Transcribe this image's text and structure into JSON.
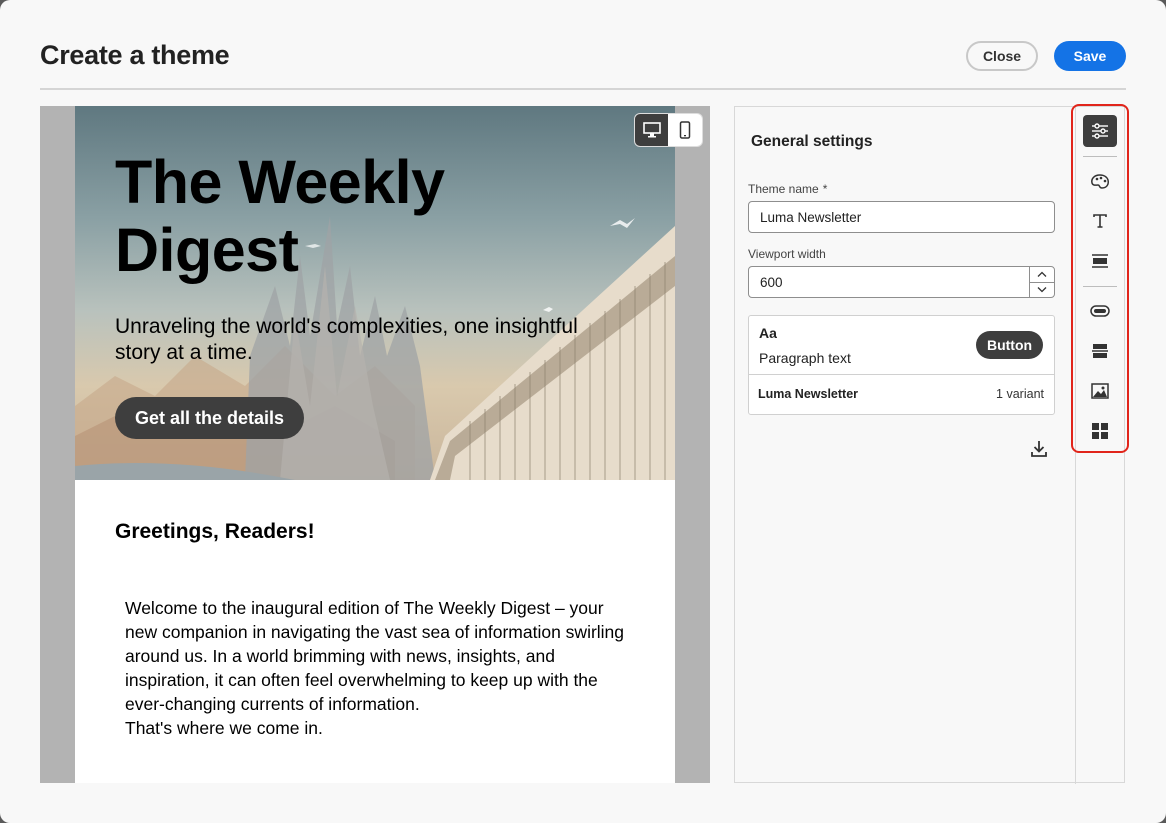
{
  "dialog": {
    "title": "Create a theme",
    "close_label": "Close",
    "save_label": "Save"
  },
  "preview": {
    "device_modes": [
      {
        "name": "desktop",
        "icon": "desktop-icon",
        "active": true
      },
      {
        "name": "mobile",
        "icon": "mobile-icon",
        "active": false
      }
    ],
    "email": {
      "hero_title": "The Weekly Digest",
      "hero_subtitle": "Unraveling the world's complexities, one insightful story at a time.",
      "cta_label": "Get all the details",
      "greeting": "Greetings, Readers!",
      "body": "Welcome to the inaugural edition of The Weekly Digest – your new companion in navigating the vast sea of information swirling around us. In a world brimming with news, insights, and inspiration, it can often feel overwhelming to keep up with the ever-changing currents of information.\nThat's where we come in."
    }
  },
  "settings": {
    "heading": "General settings",
    "theme_name": {
      "label": "Theme name",
      "required_mark": "*",
      "value": "Luma Newsletter"
    },
    "viewport_width": {
      "label": "Viewport width",
      "value": "600"
    },
    "theme_card": {
      "typography_sample": "Aa",
      "paragraph_sample": "Paragraph text",
      "button_sample": "Button",
      "theme_name": "Luma Newsletter",
      "variant_count": "1 variant"
    }
  },
  "rail": {
    "items": [
      {
        "name": "general-settings",
        "icon": "sliders-icon",
        "active": true
      },
      {
        "name": "colors",
        "icon": "palette-icon",
        "active": false
      },
      {
        "name": "typography",
        "icon": "text-icon",
        "active": false
      },
      {
        "name": "sections",
        "icon": "section-icon",
        "active": false
      },
      {
        "name": "buttons",
        "icon": "button-icon",
        "active": false
      },
      {
        "name": "dividers",
        "icon": "divider-icon",
        "active": false
      },
      {
        "name": "images",
        "icon": "image-icon",
        "active": false
      },
      {
        "name": "columns",
        "icon": "grid-icon",
        "active": false
      }
    ]
  },
  "colors": {
    "accent": "#1473e6",
    "rail_highlight": "#e1251b",
    "dark_button": "#3e3e3e"
  }
}
